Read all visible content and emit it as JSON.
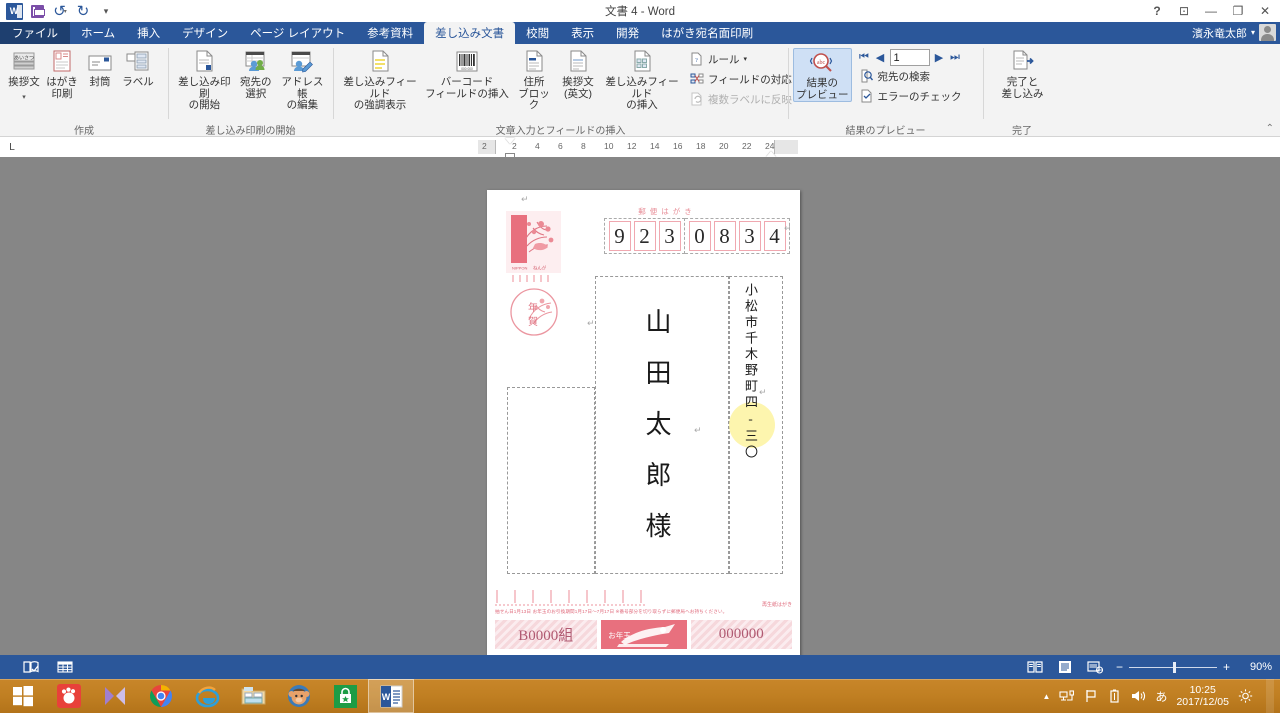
{
  "titlebar": {
    "doc_title": "文書 4 - Word",
    "quick_access": [
      {
        "name": "save",
        "label": "保存"
      },
      {
        "name": "undo",
        "label": "元に戻す"
      },
      {
        "name": "redo",
        "label": "やり直し"
      },
      {
        "name": "customize",
        "label": "クイック アクセス ツール バーのユーザー設定"
      }
    ],
    "window_buttons": {
      "help": "?",
      "ribbon_display": "⊡",
      "minimize": "—",
      "restore": "❐",
      "close": "✕"
    },
    "user_name": "濱永竜太郎"
  },
  "tabs": {
    "file": "ファイル",
    "items": [
      {
        "label": "ホーム",
        "active": false
      },
      {
        "label": "挿入",
        "active": false
      },
      {
        "label": "デザイン",
        "active": false
      },
      {
        "label": "ページ レイアウト",
        "active": false
      },
      {
        "label": "参考資料",
        "active": false
      },
      {
        "label": "差し込み文書",
        "active": true
      },
      {
        "label": "校閲",
        "active": false
      },
      {
        "label": "表示",
        "active": false
      },
      {
        "label": "開発",
        "active": false
      },
      {
        "label": "はがき宛名面印刷",
        "active": false
      }
    ]
  },
  "ribbon": {
    "groups": [
      {
        "name": "create",
        "label": "作成",
        "buttons": [
          {
            "name": "greeting-text",
            "label": "挨拶文",
            "caret": true,
            "icon": "greeting-icon"
          },
          {
            "name": "postcard-print",
            "label": "はがき\n印刷",
            "caret": true,
            "icon": "postcard-icon"
          },
          {
            "name": "envelope",
            "label": "封筒",
            "caret": false,
            "icon": "envelope-icon"
          },
          {
            "name": "label",
            "label": "ラベル",
            "caret": false,
            "icon": "label-icon"
          }
        ]
      },
      {
        "name": "start-mail-merge",
        "label": "差し込み印刷の開始",
        "buttons": [
          {
            "name": "start-mail-merge",
            "label": "差し込み印刷\nの開始",
            "caret": true,
            "icon": "doc-merge-icon"
          },
          {
            "name": "select-recipients",
            "label": "宛先の\n選択",
            "caret": true,
            "icon": "recipients-icon"
          },
          {
            "name": "edit-recipient-list",
            "label": "アドレス帳\nの編集",
            "caret": false,
            "icon": "edit-list-icon"
          }
        ]
      },
      {
        "name": "write-insert-fields",
        "label": "文章入力とフィールドの挿入",
        "buttons": [
          {
            "name": "highlight-merge-fields",
            "label": "差し込みフィールド\nの強調表示",
            "caret": false,
            "icon": "highlight-icon"
          },
          {
            "name": "insert-barcode-field",
            "label": "バーコード\nフィールドの挿入",
            "caret": true,
            "icon": "barcode-icon"
          },
          {
            "name": "address-block",
            "label": "住所\nブロック",
            "caret": false,
            "icon": "address-block-icon"
          },
          {
            "name": "greeting-line",
            "label": "挨拶文\n(英文)",
            "caret": false,
            "icon": "greeting-line-icon"
          },
          {
            "name": "insert-merge-field",
            "label": "差し込みフィールド\nの挿入",
            "caret": true,
            "icon": "insert-field-icon"
          }
        ],
        "small_buttons": [
          {
            "name": "rules",
            "label": "ルール",
            "caret": true,
            "icon": "rules-icon",
            "disabled": false
          },
          {
            "name": "match-fields",
            "label": "フィールドの対応",
            "caret": false,
            "icon": "match-fields-icon",
            "disabled": false
          },
          {
            "name": "update-labels",
            "label": "複数ラベルに反映",
            "caret": false,
            "icon": "update-labels-icon",
            "disabled": true
          }
        ]
      },
      {
        "name": "preview-results",
        "label": "結果のプレビュー",
        "buttons": [
          {
            "name": "preview-results",
            "label": "結果の\nプレビュー",
            "caret": false,
            "icon": "preview-icon",
            "selected": true
          }
        ],
        "record_nav": {
          "first": "⏮",
          "prev": "◀",
          "value": "1",
          "next": "▶",
          "last": "⏭"
        },
        "small_buttons": [
          {
            "name": "find-recipient",
            "label": "宛先の検索",
            "icon": "find-icon",
            "disabled": false
          },
          {
            "name": "check-errors",
            "label": "エラーのチェック",
            "icon": "check-errors-icon",
            "disabled": false
          }
        ]
      },
      {
        "name": "finish",
        "label": "完了",
        "buttons": [
          {
            "name": "finish-and-merge",
            "label": "完了と\n差し込み",
            "caret": true,
            "icon": "finish-icon"
          }
        ]
      }
    ],
    "collapse_arrow": "⌃"
  },
  "ruler": {
    "corner_label": "L",
    "left_edge_tick": "2",
    "ticks": [
      "2",
      "4",
      "6",
      "8",
      "10",
      "12",
      "14",
      "16",
      "18",
      "20",
      "22",
      "24"
    ]
  },
  "document": {
    "postcard": {
      "header_label": "郵便はがき",
      "postal_code": [
        "9",
        "2",
        "3",
        "0",
        "8",
        "3",
        "4"
      ],
      "address_vertical": "小松市千木野町四-三〇",
      "recipient_vertical": "山田太郎様",
      "stamp_text": "年賀",
      "stamp_country": "NIPPON",
      "fine_print": "抽せん日1月13日 お年玉のお引換期間1月17日～7月17日 ※番号部分を切り取らずに郵便局へお持ちください。",
      "recycle_note": "再生紙はがき",
      "lottery_left": "B0000組",
      "lottery_center": "お年玉",
      "lottery_right": "000000"
    }
  },
  "statusbar": {
    "left_icons": [
      {
        "name": "proofing-icon",
        "label": "文章校正"
      },
      {
        "name": "merge-data-icon",
        "label": "差し込みデータ"
      }
    ],
    "views": [
      {
        "name": "read-mode",
        "label": "閲覧モード"
      },
      {
        "name": "print-layout",
        "label": "印刷レイアウト"
      },
      {
        "name": "web-layout",
        "label": "Web レイアウト"
      }
    ],
    "zoom_minus": "−",
    "zoom_plus": "+",
    "zoom_level": "90%"
  },
  "taskbar": {
    "start_label": "スタート",
    "items": [
      {
        "name": "taskbar-gom-player",
        "label": "GOM Player"
      },
      {
        "name": "taskbar-media-player",
        "label": "Windows Media Player"
      },
      {
        "name": "taskbar-chrome",
        "label": "Google Chrome"
      },
      {
        "name": "taskbar-internet-explorer",
        "label": "Internet Explorer"
      },
      {
        "name": "taskbar-file-explorer",
        "label": "エクスプローラー"
      },
      {
        "name": "taskbar-monkey-app",
        "label": "アプリ"
      },
      {
        "name": "taskbar-store",
        "label": "ストア"
      },
      {
        "name": "taskbar-word",
        "label": "Word",
        "active": true
      }
    ],
    "tray": {
      "overflow": "▲",
      "icons": [
        {
          "name": "network-icon",
          "label": "ネットワーク"
        },
        {
          "name": "flag-icon",
          "label": "アクション センター"
        },
        {
          "name": "battery-icon",
          "label": "バッテリ"
        },
        {
          "name": "volume-icon",
          "label": "音量"
        }
      ],
      "ime": "あ",
      "time": "10:25",
      "date": "2017/12/05",
      "brightness_icon": "brightness-icon"
    }
  },
  "colors": {
    "word_blue": "#2b579a",
    "ribbon_bg": "#f3f3f3",
    "canvas_gray": "#868686",
    "postcard_red": "#e8707e",
    "highlight_yellow": "#fdf3a0",
    "taskbar_orange": "#c07f22"
  }
}
